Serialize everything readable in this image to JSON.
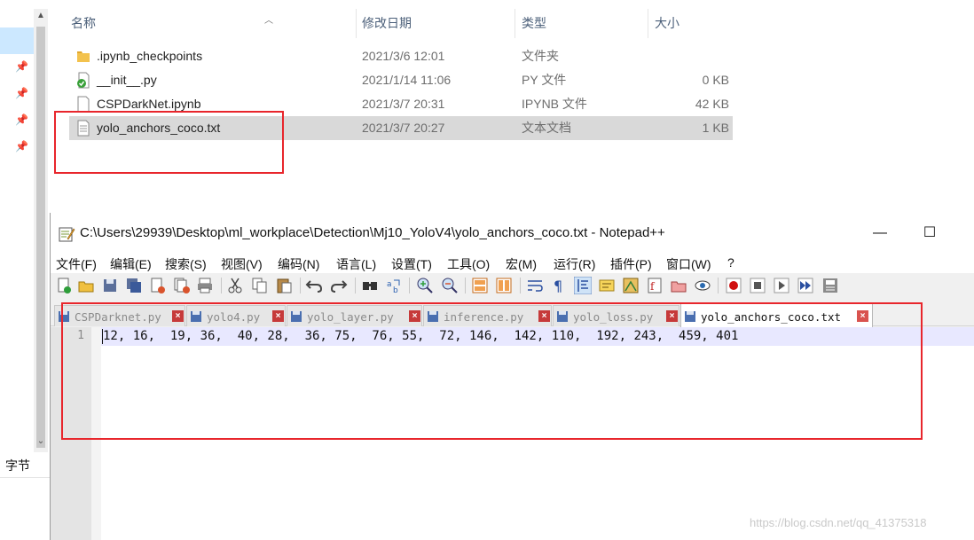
{
  "explorer": {
    "columns": {
      "name": "名称",
      "modified": "修改日期",
      "type": "类型",
      "size": "大小"
    },
    "files": [
      {
        "name": ".ipynb_checkpoints",
        "modified": "2021/3/6 12:01",
        "type": "文件夹",
        "size": "",
        "icon": "folder-icon"
      },
      {
        "name": "__init__.py",
        "modified": "2021/1/14 11:06",
        "type": "PY 文件",
        "size": "0 KB",
        "icon": "python-file-icon"
      },
      {
        "name": "CSPDarkNet.ipynb",
        "modified": "2021/3/7 20:31",
        "type": "IPYNB 文件",
        "size": "42 KB",
        "icon": "document-icon"
      },
      {
        "name": "yolo_anchors_coco.txt",
        "modified": "2021/3/7 20:27",
        "type": "文本文档",
        "size": "1 KB",
        "icon": "text-file-icon",
        "selected": true
      }
    ],
    "left_label": "字节"
  },
  "notepad": {
    "title": "C:\\Users\\29939\\Desktop\\ml_workplace\\Detection\\Mj10_YoloV4\\yolo_anchors_coco.txt - Notepad++",
    "menu": [
      "文件(F)",
      "编辑(E)",
      "搜索(S)",
      "视图(V)",
      "编码(N)",
      "语言(L)",
      "设置(T)",
      "工具(O)",
      "宏(M)",
      "运行(R)",
      "插件(P)",
      "窗口(W)",
      "?"
    ],
    "tabs": [
      {
        "label": "CSPDarknet.py",
        "active": false
      },
      {
        "label": "yolo4.py",
        "active": false
      },
      {
        "label": "yolo_layer.py",
        "active": false
      },
      {
        "label": "inference.py",
        "active": false
      },
      {
        "label": "yolo_loss.py",
        "active": false
      },
      {
        "label": "yolo_anchors_coco.txt",
        "active": true
      }
    ],
    "editor": {
      "line_number": "1",
      "line_text": "12, 16,  19, 36,  40, 28,  36, 75,  76, 55,  72, 146,  142, 110,  192, 243,  459, 401"
    }
  },
  "watermark": "https://blog.csdn.net/qq_41375318",
  "colors": {
    "highlight_box": "#e8262c",
    "selection": "#d9d9d9",
    "current_line": "#e8e8ff"
  }
}
